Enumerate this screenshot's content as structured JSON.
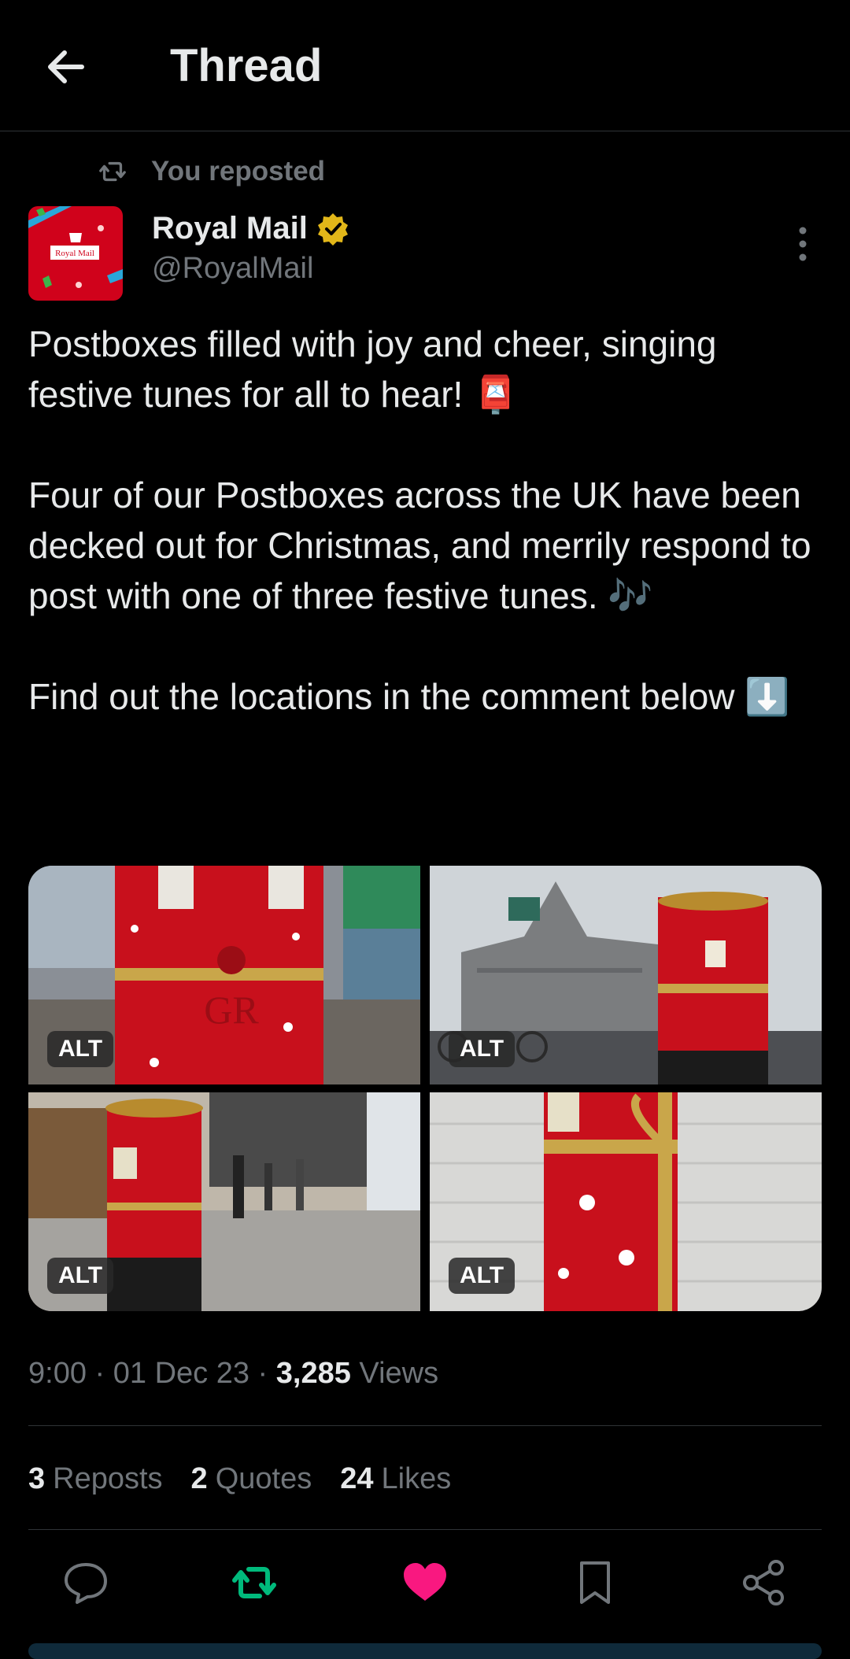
{
  "header": {
    "title": "Thread"
  },
  "repost": {
    "label": "You reposted"
  },
  "author": {
    "name": "Royal Mail",
    "handle": "@RoyalMail",
    "avatar_text": "Royal Mail"
  },
  "post": {
    "paragraphs": [
      "Postboxes filled with joy and cheer, singing festive tunes for all to hear! 📮",
      "Four of our Postboxes across the UK have been decked out for Christmas, and merrily respond to post with one of three festive tunes. 🎶",
      "Find out the locations in the comment below ⬇️"
    ],
    "media": [
      {
        "alt_label": "ALT",
        "description": "red postbox with GR crest"
      },
      {
        "alt_label": "ALT",
        "description": "red postbox in city square"
      },
      {
        "alt_label": "ALT",
        "description": "red postbox on shopping street"
      },
      {
        "alt_label": "ALT",
        "description": "red postbox with gold ribbon"
      }
    ]
  },
  "meta": {
    "time": "9:00",
    "date": "01 Dec 23",
    "views_count": "3,285",
    "views_label": "Views"
  },
  "stats": [
    {
      "count": "3",
      "label": "Reposts"
    },
    {
      "count": "2",
      "label": "Quotes"
    },
    {
      "count": "24",
      "label": "Likes"
    }
  ],
  "colors": {
    "background": "#000000",
    "text": "#e7e9ea",
    "muted": "#71767b",
    "repost_green": "#00ba7c",
    "like_pink": "#f91880",
    "verified_gold": "#e2b719",
    "royal_red": "#d0021b"
  },
  "actions": [
    {
      "name": "reply-icon"
    },
    {
      "name": "repost-icon",
      "active": true
    },
    {
      "name": "like-icon",
      "active": true
    },
    {
      "name": "bookmark-icon"
    },
    {
      "name": "share-icon"
    }
  ]
}
